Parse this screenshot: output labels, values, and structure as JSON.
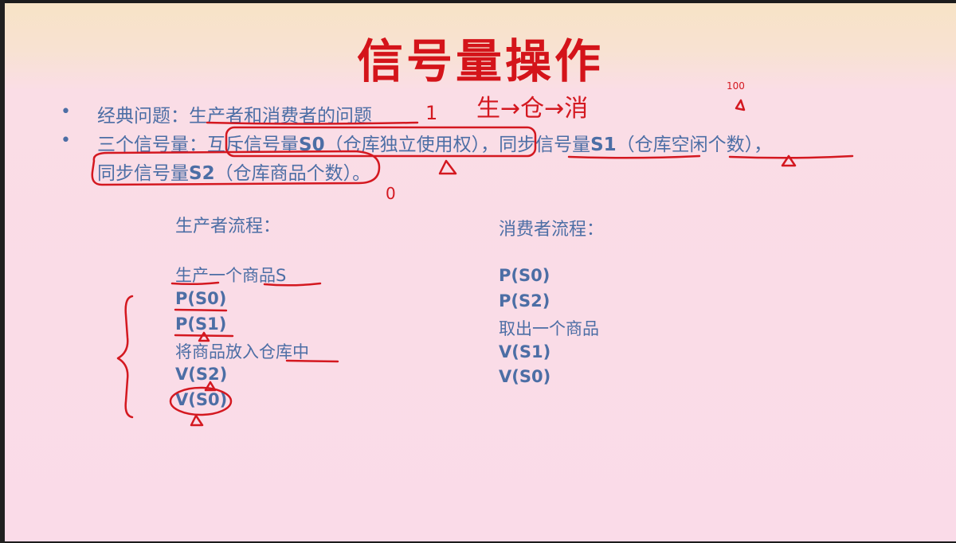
{
  "slide": {
    "title": "信号量操作",
    "bullets": [
      {
        "marker": "•",
        "prefix": "经典问题：",
        "text": "生产者和消费者的问题"
      },
      {
        "marker": "•",
        "line1_prefix": "三个信号量：",
        "sem_mutex_label": "互斥信号量",
        "sem_mutex_name": "S0",
        "sem_mutex_desc": "（仓库独立使用权）",
        "sep1": "，",
        "sem_sync1_label": "同步信号量",
        "sem_sync1_name": "S1",
        "sem_sync1_desc": "（仓库空闲个数）",
        "sep2": "，",
        "sem_sync2_label": "同步信号量",
        "sem_sync2_name": "S2",
        "sem_sync2_desc": "（仓库商品个数）",
        "end": "。"
      }
    ],
    "producer": {
      "heading": "生产者流程：",
      "steps": [
        "生产一个商品S",
        "P(S0)",
        "P(S1)",
        "将商品放入仓库中",
        "V(S2)",
        "V(S0)"
      ]
    },
    "consumer": {
      "heading": "消费者流程：",
      "steps": [
        "P(S0)",
        "P(S2)",
        "取出一个商品",
        "V(S1)",
        "V(S0)"
      ]
    },
    "handwriting": {
      "note_flow": "生→仓→消",
      "note_one": "1",
      "note_hundred": "100",
      "note_zero": "0"
    }
  }
}
